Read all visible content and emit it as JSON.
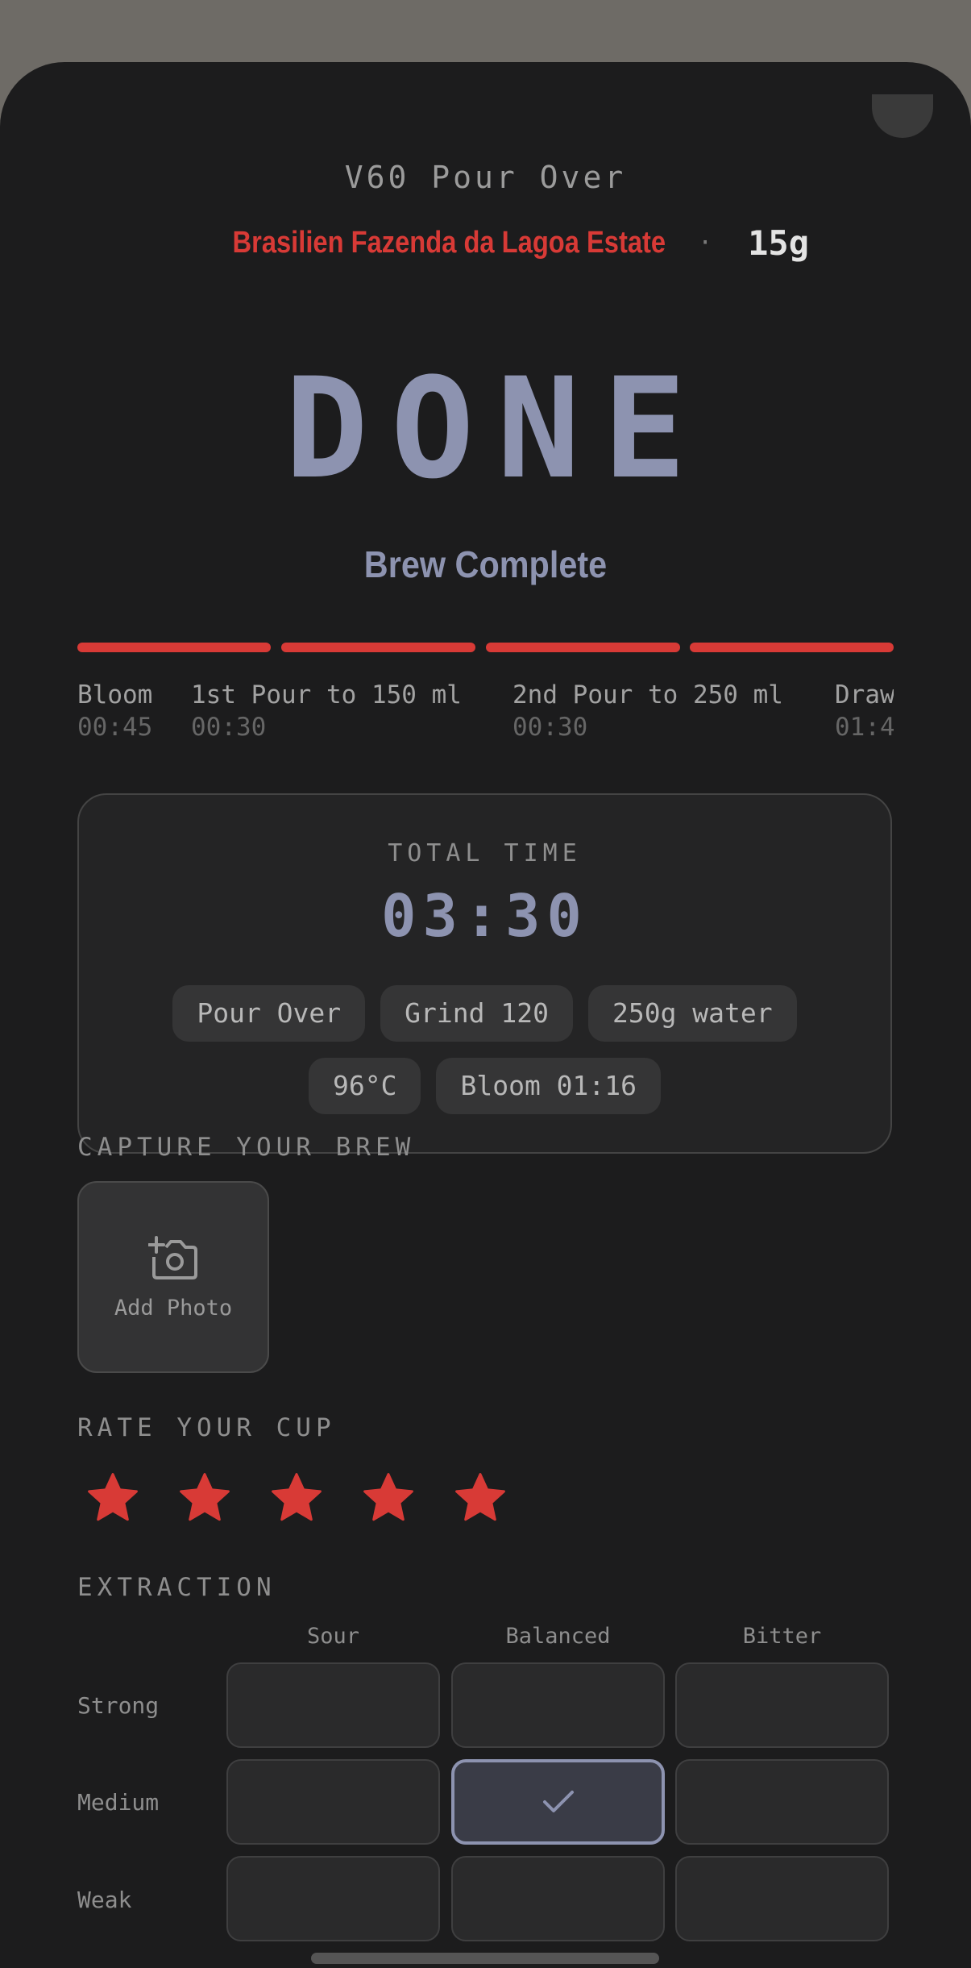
{
  "header": {
    "method": "V60 Pour Over",
    "bean": "Brasilien Fazenda da Lagoa Estate",
    "separator": "·",
    "dose": "15g"
  },
  "status": {
    "big": "DONE",
    "subtitle": "Brew Complete"
  },
  "progress": {
    "segments": 4,
    "completed": 4,
    "color": "#d83a36"
  },
  "steps": [
    {
      "name": "Bloom",
      "time": "00:45"
    },
    {
      "name": "1st Pour to 150 ml",
      "time": "00:30"
    },
    {
      "name": "2nd Pour to 250 ml",
      "time": "00:30"
    },
    {
      "name": "Draw",
      "time": "01:4"
    }
  ],
  "summary": {
    "label": "TOTAL TIME",
    "time": "03:30",
    "chips": [
      "Pour Over",
      "Grind 120",
      "250g water",
      "96°C",
      "Bloom 01:16"
    ]
  },
  "capture": {
    "title": "CAPTURE YOUR BREW",
    "button": "Add Photo",
    "icon": "add-camera-icon"
  },
  "rating": {
    "title": "RATE YOUR CUP",
    "value": 5,
    "max": 5,
    "color": "#d83a36"
  },
  "extraction": {
    "title": "EXTRACTION",
    "columns": [
      "Sour",
      "Balanced",
      "Bitter"
    ],
    "rows": [
      "Strong",
      "Medium",
      "Weak"
    ],
    "selected": {
      "row": "Medium",
      "column": "Balanced"
    }
  },
  "colors": {
    "accent": "#d83a36",
    "highlight": "#8d93b0",
    "background": "#1c1c1d"
  }
}
